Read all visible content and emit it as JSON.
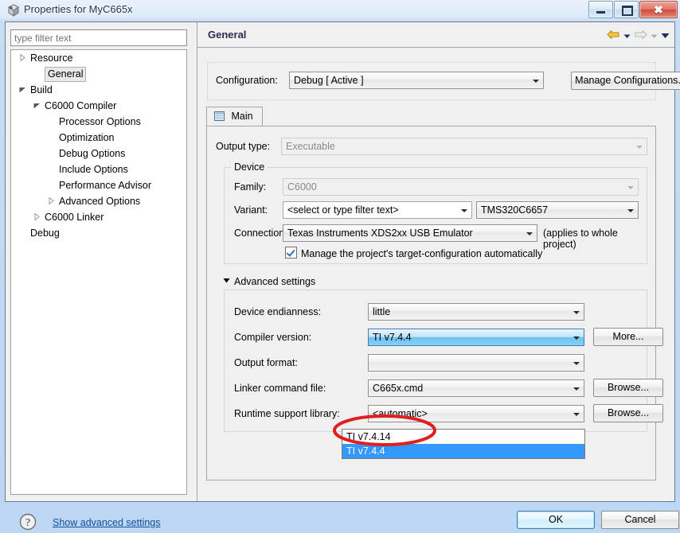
{
  "window": {
    "title": "Properties for MyC665x",
    "icon": "properties-dialog-icon",
    "minimize_label": "Minimize",
    "maximize_label": "Maximize",
    "close_label": "Close"
  },
  "sidebar": {
    "filter_placeholder": "type filter text",
    "filter_value": "",
    "items": [
      {
        "label": "Resource",
        "indent": 0,
        "arrow": "collapsed",
        "selected": false
      },
      {
        "label": "General",
        "indent": 1,
        "arrow": "none",
        "selected": true
      },
      {
        "label": "Build",
        "indent": 0,
        "arrow": "expanded",
        "selected": false
      },
      {
        "label": "C6000 Compiler",
        "indent": 1,
        "arrow": "expanded",
        "selected": false
      },
      {
        "label": "Processor Options",
        "indent": 2,
        "arrow": "none",
        "selected": false
      },
      {
        "label": "Optimization",
        "indent": 2,
        "arrow": "none",
        "selected": false
      },
      {
        "label": "Debug Options",
        "indent": 2,
        "arrow": "none",
        "selected": false
      },
      {
        "label": "Include Options",
        "indent": 2,
        "arrow": "none",
        "selected": false
      },
      {
        "label": "Performance Advisor",
        "indent": 2,
        "arrow": "none",
        "selected": false
      },
      {
        "label": "Advanced Options",
        "indent": 2,
        "arrow": "collapsed",
        "selected": false
      },
      {
        "label": "C6000 Linker",
        "indent": 1,
        "arrow": "collapsed",
        "selected": false
      },
      {
        "label": "Debug",
        "indent": 0,
        "arrow": "none",
        "selected": false
      }
    ]
  },
  "page": {
    "title": "General",
    "nav": {
      "back_icon": "left-arrow-icon",
      "back_menu_icon": "chevron-down-icon",
      "forward_icon": "right-arrow-icon",
      "forward_menu_icon": "chevron-down-icon",
      "view_menu_icon": "chevron-down-icon"
    }
  },
  "configuration": {
    "label": "Configuration:",
    "value": "Debug  [ Active ]",
    "manage_button": "Manage Configurations..."
  },
  "tabs": [
    {
      "label": "Main",
      "icon": "main-tab-icon",
      "active": true
    }
  ],
  "main": {
    "output_type": {
      "label": "Output type:",
      "value": "Executable",
      "disabled": true
    },
    "device": {
      "group_title": "Device",
      "family": {
        "label": "Family:",
        "value": "C6000",
        "disabled": true
      },
      "variant": {
        "label": "Variant:",
        "filter_value": "<select or type filter text>",
        "value": "TMS320C6657"
      },
      "connection": {
        "label": "Connection:",
        "value": "Texas Instruments XDS2xx USB Emulator",
        "note": "(applies to whole project)"
      },
      "manage_checkbox": {
        "label": "Manage the project's target-configuration automatically",
        "checked": true
      }
    },
    "advanced": {
      "toggle_label": "Advanced settings",
      "expanded": true,
      "rows": [
        {
          "label": "Device endianness:",
          "value": "little",
          "button": null
        },
        {
          "label": "Compiler version:",
          "value": "TI v7.4.4",
          "button": "More..."
        },
        {
          "label": "Output format:",
          "value": "",
          "button": null
        },
        {
          "label": "Linker command file:",
          "value": "C665x.cmd",
          "button": "Browse..."
        },
        {
          "label": "Runtime support library:",
          "value": "<automatic>",
          "button": "Browse..."
        }
      ],
      "compiler_version_dropdown": {
        "open": true,
        "options": [
          {
            "label": "TI v7.4.14",
            "highlighted": false
          },
          {
            "label": "TI v7.4.4",
            "highlighted": true
          }
        ]
      }
    }
  },
  "annotation": {
    "shape": "red-ellipse-highlight",
    "color": "#e02020",
    "target": "TI v7.4.4"
  },
  "footer": {
    "help_icon": "question-mark-icon",
    "link": "Show advanced settings",
    "ok": "OK",
    "cancel": "Cancel"
  }
}
